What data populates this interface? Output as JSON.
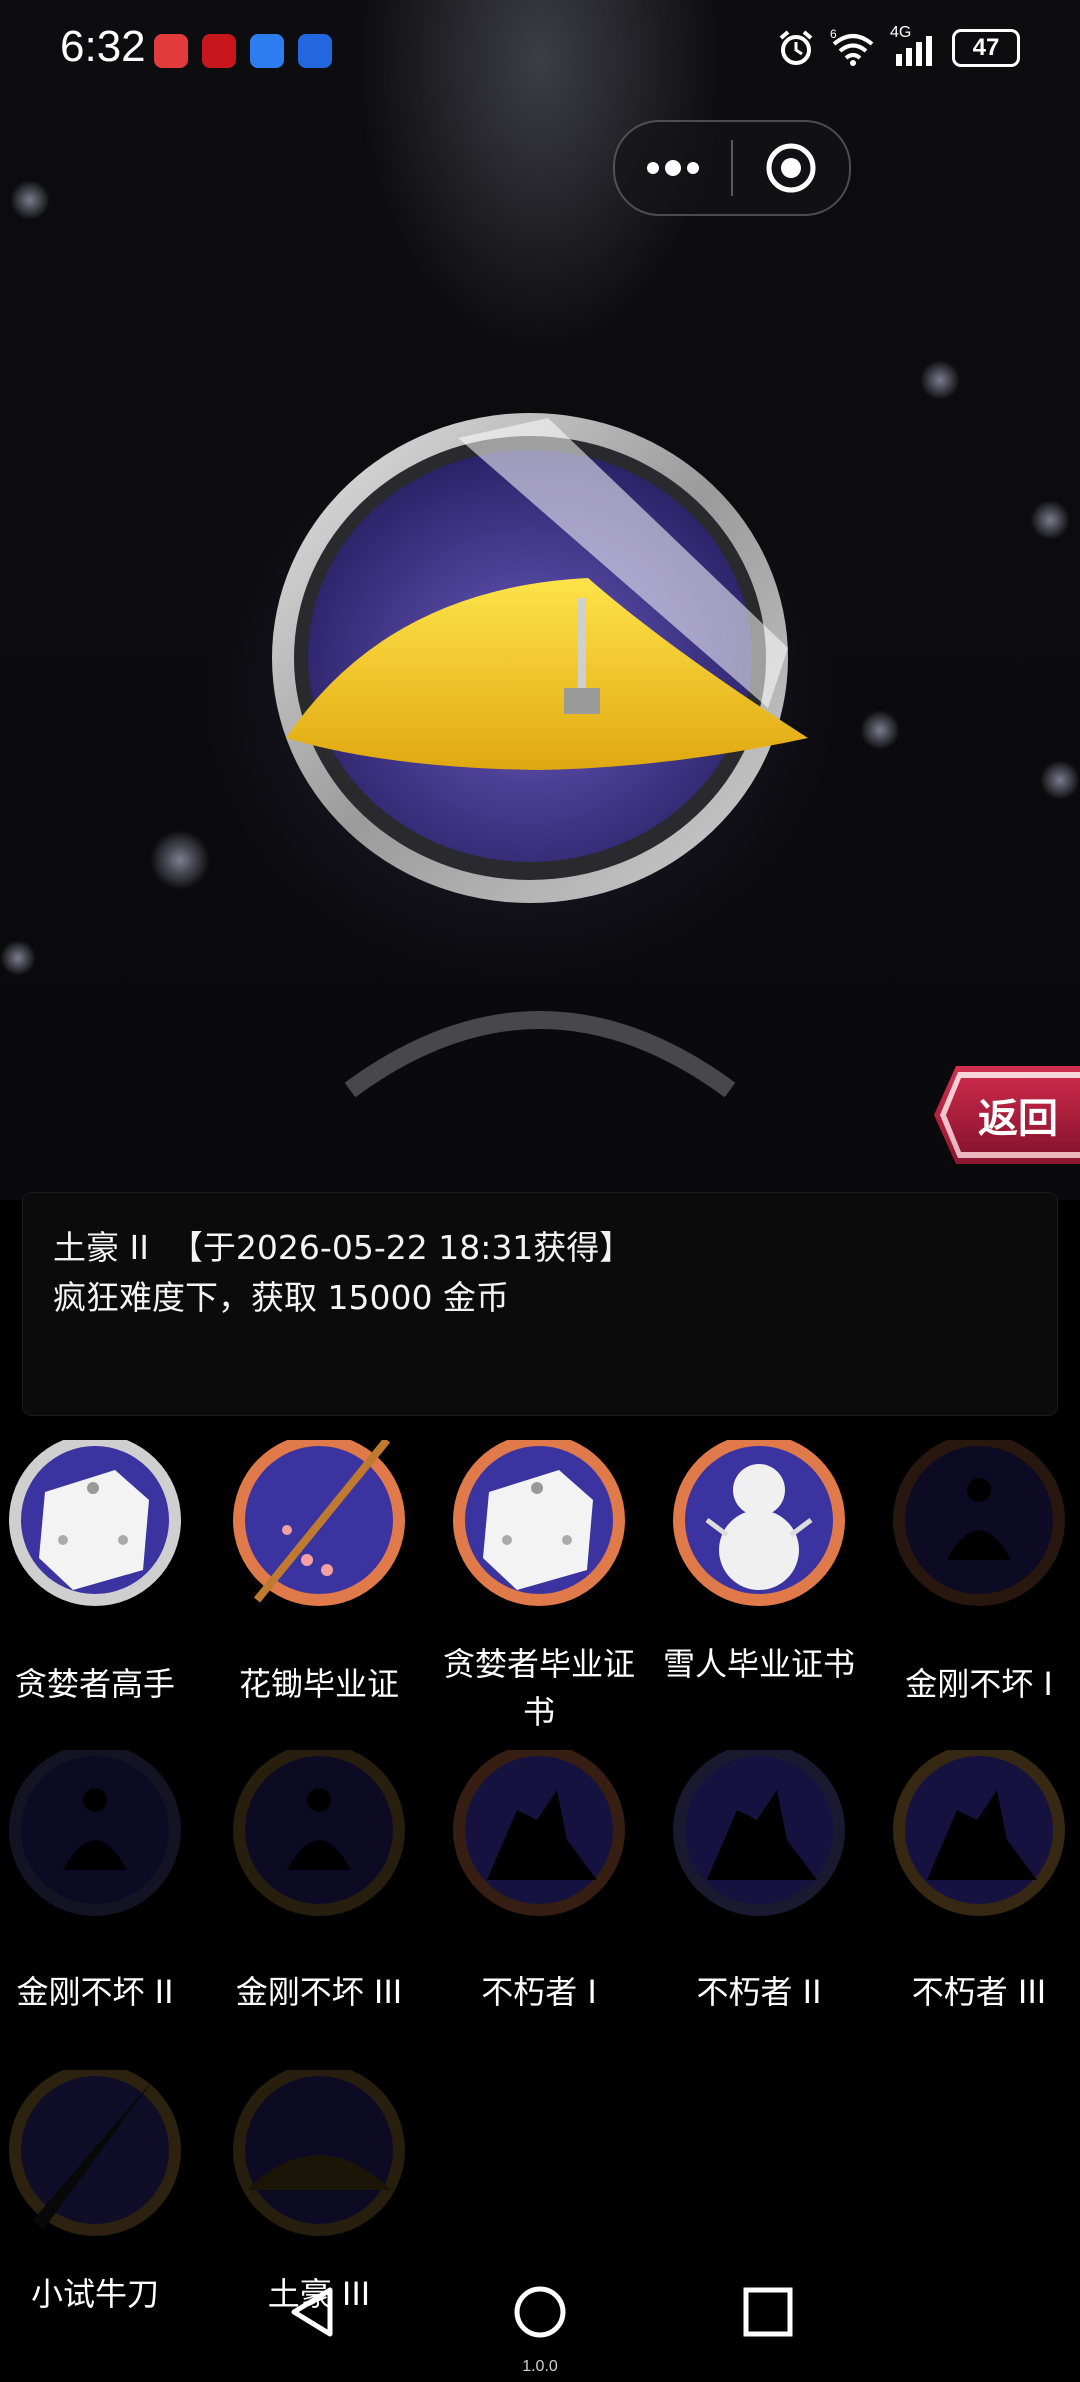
{
  "status_bar": {
    "time": "6:32",
    "network": "4G",
    "battery": "47",
    "wifi_badge": "6"
  },
  "capsule": {
    "more_icon": "more-dots-icon",
    "close_icon": "target-close-icon"
  },
  "return_button": {
    "label": "返回"
  },
  "achievement": {
    "line1": "土豪 II  【于2026-05-22 18:31获得】",
    "line2": "疯狂难度下，获取 15000 金币"
  },
  "achievements_grid": [
    {
      "label": "贪婪者高手",
      "state": "unlocked",
      "icon": "dice-icon"
    },
    {
      "label": "花锄毕业证",
      "state": "unlocked",
      "icon": "hoe-icon"
    },
    {
      "label": "贪婪者毕业证书",
      "state": "unlocked",
      "icon": "dice-icon"
    },
    {
      "label": "雪人毕业证书",
      "state": "unlocked",
      "icon": "snowman-icon"
    },
    {
      "label": "金刚不坏 I",
      "state": "locked",
      "icon": "meditation-icon"
    },
    {
      "label": "金刚不坏 II",
      "state": "locked",
      "icon": "meditation-icon"
    },
    {
      "label": "金刚不坏 III",
      "state": "locked",
      "icon": "meditation-icon"
    },
    {
      "label": "不朽者 I",
      "state": "locked",
      "icon": "warrior-icon"
    },
    {
      "label": "不朽者 II",
      "state": "locked",
      "icon": "warrior-icon"
    },
    {
      "label": "不朽者 III",
      "state": "locked",
      "icon": "warrior-icon"
    },
    {
      "label": "小试牛刀",
      "state": "locked",
      "icon": "knife-icon"
    },
    {
      "label": "土豪 III",
      "state": "locked",
      "icon": "gold-pile-icon"
    }
  ],
  "nav": {
    "version": "1.0.0"
  },
  "colors": {
    "accent_red": "#c92948",
    "gold": "#f2c21a",
    "badge_blue": "#3a2f9a"
  }
}
